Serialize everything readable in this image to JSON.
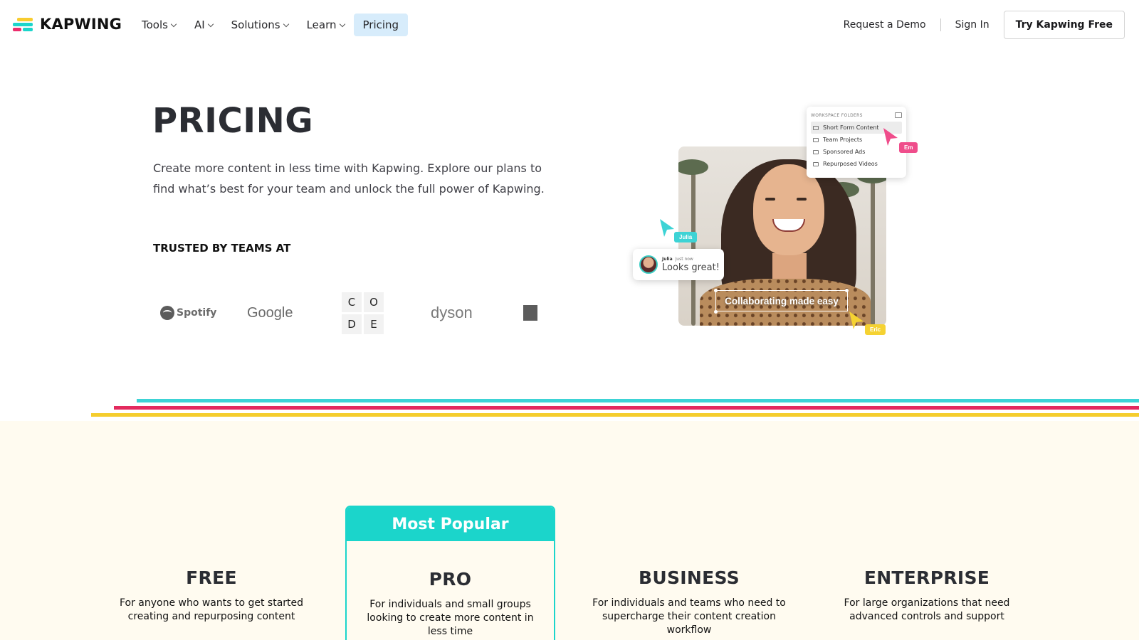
{
  "header": {
    "logo_text": "KAPWING",
    "menu": [
      {
        "label": "Tools",
        "dropdown": true
      },
      {
        "label": "AI",
        "dropdown": true
      },
      {
        "label": "Solutions",
        "dropdown": true
      },
      {
        "label": "Learn",
        "dropdown": true
      },
      {
        "label": "Pricing",
        "dropdown": false,
        "active": true
      }
    ],
    "request_demo": "Request a Demo",
    "sign_in": "Sign In",
    "cta": "Try Kapwing Free"
  },
  "hero": {
    "title": "PRICING",
    "description": "Create more content in less time with Kapwing. Explore our plans to find what’s best for your team and unlock the full power of Kapwing.",
    "trusted_label": "TRUSTED BY TEAMS AT",
    "logos": {
      "spotify": "Spotify",
      "google": "Google",
      "code": [
        "C",
        "O",
        "D",
        "E"
      ],
      "dyson": "dyson"
    }
  },
  "illustration": {
    "folder_header": "WORKSPACE FOLDERS",
    "folders": [
      "Short Form Content",
      "Team Projects",
      "Sponsored Ads",
      "Repurposed Videos"
    ],
    "cursors": {
      "em": "Em",
      "julia": "Julia",
      "eric": "Eric"
    },
    "comment": {
      "author": "Julia",
      "time": "Just now",
      "text": "Looks great!"
    },
    "caption": "Collaborating made easy"
  },
  "plans": {
    "most_popular": "Most Popular",
    "free": {
      "name": "FREE",
      "desc": "For anyone who wants to get started creating and repurposing content"
    },
    "pro": {
      "name": "PRO",
      "desc": "For individuals and small groups looking to create more content in less time"
    },
    "business": {
      "name": "BUSINESS",
      "desc": "For individuals and teams who need to supercharge their content creation workflow"
    },
    "enterprise": {
      "name": "ENTERPRISE",
      "desc": "For large organizations that need advanced controls and support"
    }
  },
  "colors": {
    "accent_cyan": "#1bd5cb",
    "accent_pink": "#e32a5e",
    "accent_yellow": "#f5cd2d",
    "pricing_bg": "#fffbf0",
    "active_nav_bg": "#d7ecfb"
  }
}
